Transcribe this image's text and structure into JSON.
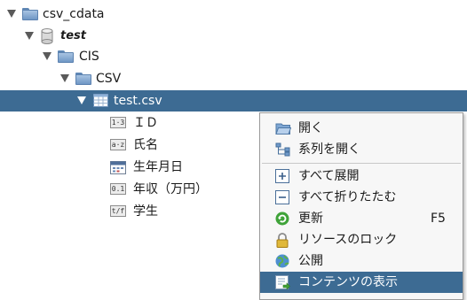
{
  "tree": {
    "root_label": "csv_cdata",
    "db_label": "test",
    "schema_label": "CIS",
    "folder_label": "CSV",
    "table_label": "test.csv",
    "columns": [
      {
        "label": "ＩＤ",
        "type_icon": "integer-type-icon"
      },
      {
        "label": "氏名",
        "type_icon": "string-type-icon"
      },
      {
        "label": "生年月日",
        "type_icon": "date-type-icon"
      },
      {
        "label": "年収（万円）",
        "type_icon": "decimal-type-icon"
      },
      {
        "label": "学生",
        "type_icon": "boolean-type-icon"
      }
    ],
    "badges": {
      "int": "1·3",
      "str": "a·z",
      "dec": "0.1",
      "bool": "t/f"
    }
  },
  "context_menu": {
    "items": [
      {
        "label": "開く"
      },
      {
        "label": "系列を開く"
      },
      {
        "label": "すべて展開"
      },
      {
        "label": "すべて折りたたむ"
      },
      {
        "label": "更新",
        "shortcut": "F5"
      },
      {
        "label": "リソースのロック"
      },
      {
        "label": "公開"
      },
      {
        "label": "コンテンツの表示"
      }
    ]
  },
  "colors": {
    "selection": "#3d6b93",
    "folder": "#7fa3cc"
  }
}
